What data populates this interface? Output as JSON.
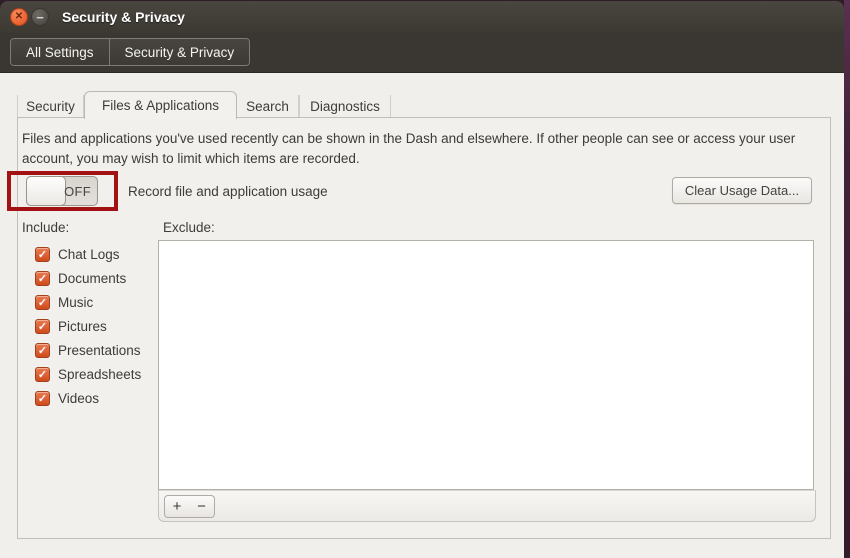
{
  "window": {
    "title": "Security & Privacy"
  },
  "icons": {
    "close": "✕",
    "minimize": "−",
    "check": "✓"
  },
  "breadcrumb": {
    "items": [
      {
        "label": "All Settings"
      },
      {
        "label": "Security & Privacy"
      }
    ]
  },
  "tabs": [
    {
      "label": "Security",
      "active": false
    },
    {
      "label": "Files & Applications",
      "active": true
    },
    {
      "label": "Search",
      "active": false
    },
    {
      "label": "Diagnostics",
      "active": false
    }
  ],
  "files_tab": {
    "description": "Files and applications you've used recently can be shown in the Dash and elsewhere. If other people can see or access your user account, you may wish to limit which items are recorded.",
    "record_usage": {
      "toggle_state": "OFF",
      "toggle_on": false,
      "label": "Record file and application usage"
    },
    "clear_button_label": "Clear Usage Data...",
    "include": {
      "label": "Include:",
      "items": [
        {
          "label": "Chat Logs",
          "checked": true
        },
        {
          "label": "Documents",
          "checked": true
        },
        {
          "label": "Music",
          "checked": true
        },
        {
          "label": "Pictures",
          "checked": true
        },
        {
          "label": "Presentations",
          "checked": true
        },
        {
          "label": "Spreadsheets",
          "checked": true
        },
        {
          "label": "Videos",
          "checked": true
        }
      ]
    },
    "exclude": {
      "label": "Exclude:",
      "items": []
    },
    "list_toolbar": {
      "add_label": "+",
      "remove_label": "−"
    }
  },
  "colors": {
    "annotation_red": "#a31212",
    "checkbox_orange": "#d44a1d",
    "close_button_orange": "#e85d2c",
    "titlebar_dark": "#3c3933",
    "window_bg": "#f1efeb"
  }
}
